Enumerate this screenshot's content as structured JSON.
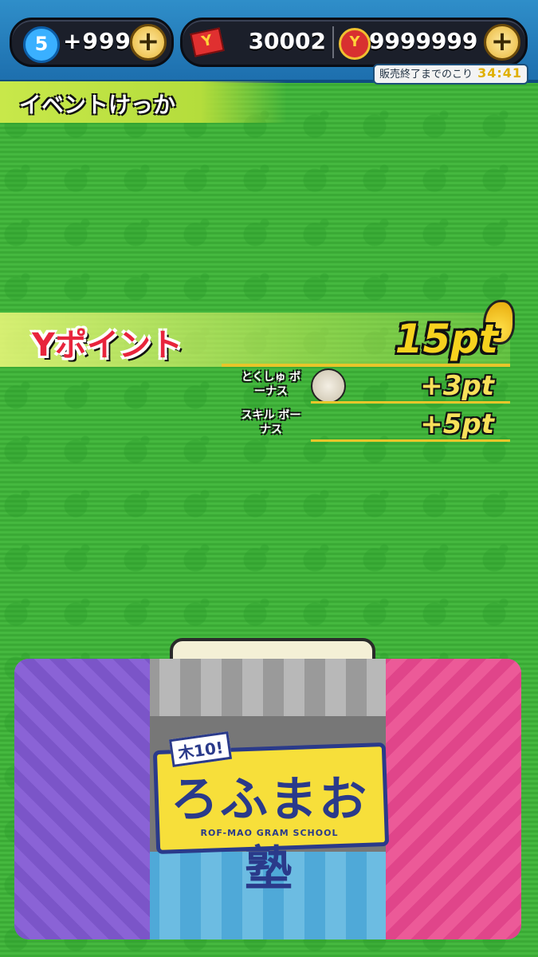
{
  "topbar": {
    "level": "5",
    "stamina": "+999",
    "plus": "+",
    "ticket_icon": "Y",
    "tickets": "30002",
    "coin_icon": "Y",
    "coins": "9999999",
    "sale_label": "販売終了までのこり",
    "sale_timer": "34:41"
  },
  "result": {
    "title": "イベントけっか"
  },
  "points": {
    "label": "Yポイント",
    "total": "15pt",
    "bonuses": [
      {
        "label": "とくしゅ ボーナス",
        "value": "+3pt"
      },
      {
        "label": "スキル ボーナス",
        "value": "+5pt"
      }
    ]
  },
  "banner": {
    "tag": "木10!",
    "title": "ろふまお塾",
    "subtitle": "ROF-MAO GRAM SCHOOL"
  },
  "colors": {
    "background": "#3fb23a",
    "accent_yellow": "#f7d21e",
    "points_red": "#e8243c"
  }
}
